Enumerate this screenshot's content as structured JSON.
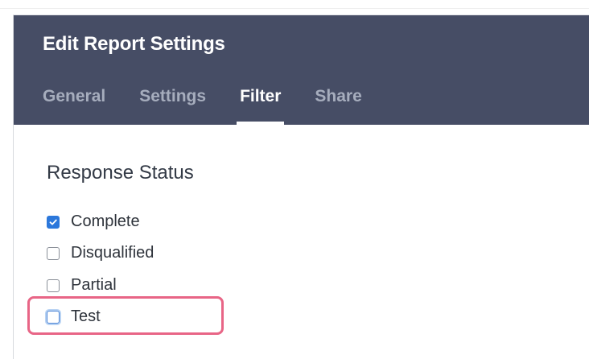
{
  "header": {
    "title": "Edit Report Settings",
    "tabs": [
      {
        "label": "General",
        "active": false
      },
      {
        "label": "Settings",
        "active": false
      },
      {
        "label": "Filter",
        "active": true
      },
      {
        "label": "Share",
        "active": false
      }
    ]
  },
  "filter": {
    "section_title": "Response Status",
    "options": [
      {
        "label": "Complete",
        "checked": true
      },
      {
        "label": "Disqualified",
        "checked": false
      },
      {
        "label": "Partial",
        "checked": false
      },
      {
        "label": "Test",
        "checked": false,
        "focused": true
      }
    ]
  },
  "colors": {
    "header_background": "#464d65",
    "accent": "#2c78db",
    "highlight": "#e86586"
  }
}
